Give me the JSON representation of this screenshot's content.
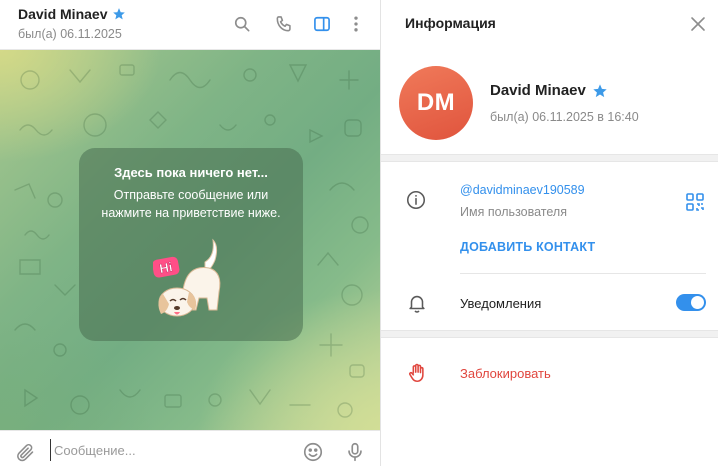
{
  "chat": {
    "title": "David Minaev",
    "status": "был(а) 06.11.2025",
    "header_icons": [
      "search-icon",
      "phone-icon",
      "sidebar-toggle-icon",
      "more-vertical-icon"
    ],
    "empty_state": {
      "title": "Здесь пока ничего нет...",
      "subtitle": "Отправьте сообщение или\nнажмите на приветствие ниже.",
      "sticker_text": "Hi"
    },
    "composer": {
      "placeholder": "Сообщение...",
      "icons": [
        "paperclip-icon",
        "emoji-icon",
        "microphone-icon"
      ]
    }
  },
  "info": {
    "title": "Информация",
    "avatar_initials": "DM",
    "name": "David Minaev",
    "last_seen": "был(а) 06.11.2025 в 16:40",
    "username": "@davidminaev190589",
    "username_label": "Имя пользователя",
    "add_contact": "ДОБАВИТЬ КОНТАКТ",
    "notifications_label": "Уведомления",
    "notifications_on": true,
    "block_label": "Заблокировать"
  },
  "colors": {
    "accent": "#3390ec",
    "danger": "#e0463e",
    "avatar": "#e35c43",
    "muted_text": "#8a8a8a"
  }
}
